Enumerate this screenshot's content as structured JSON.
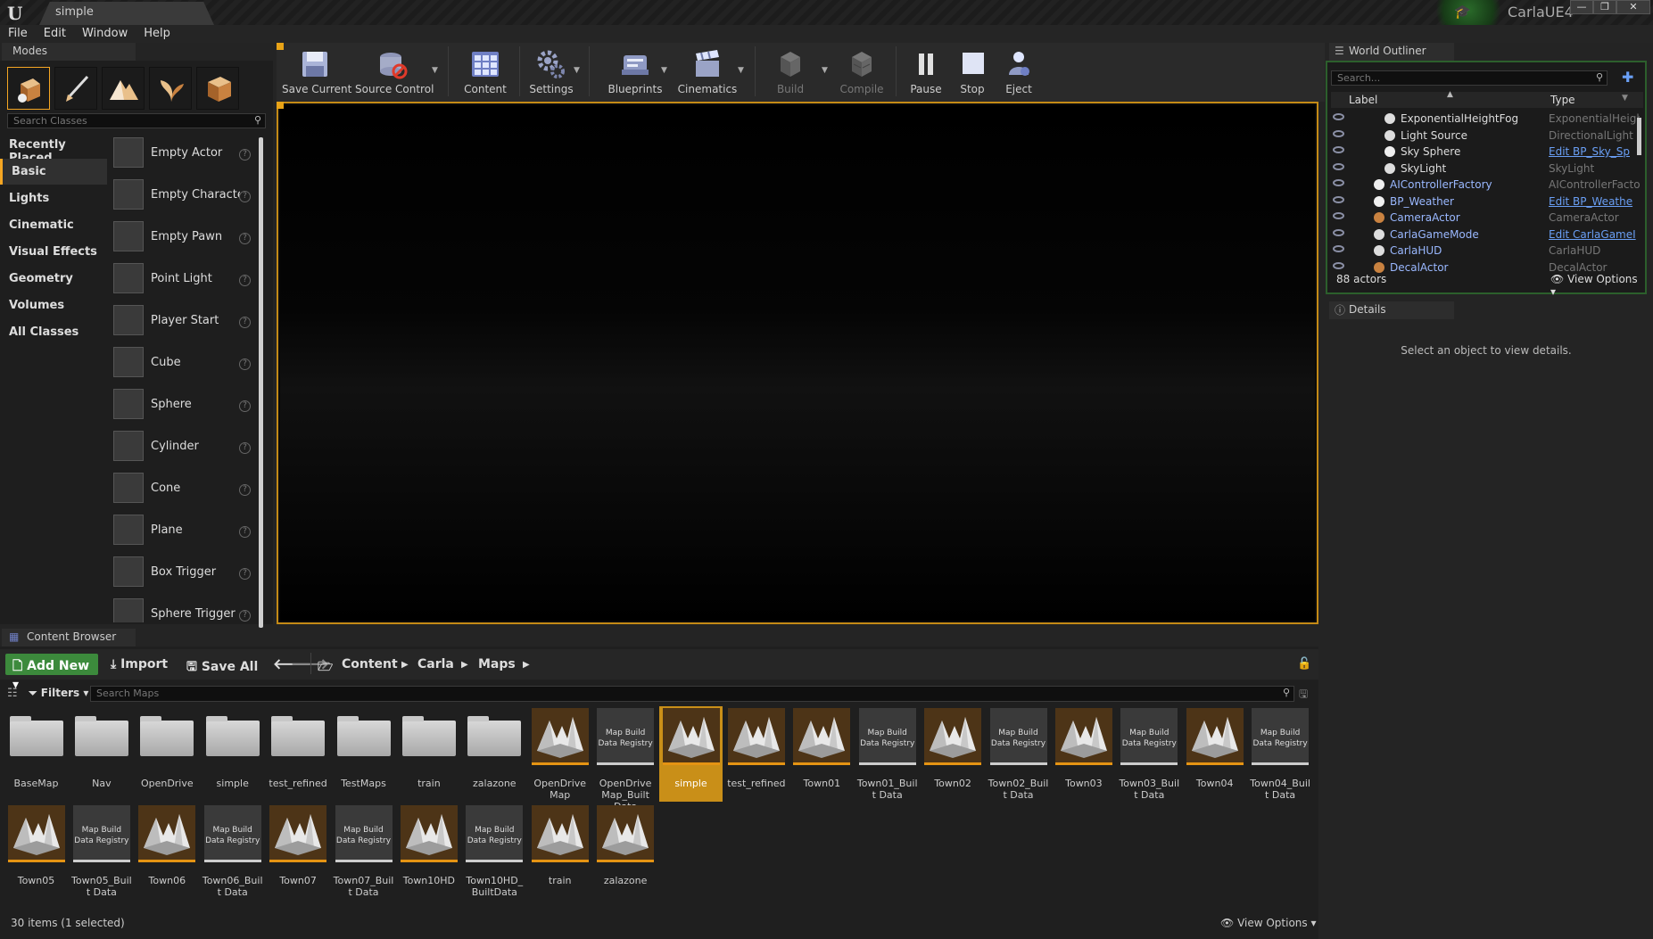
{
  "window": {
    "doc_tab": "simple",
    "project_name": "CarlaUE4",
    "minimize": "—",
    "maximize": "❐",
    "close": "✕"
  },
  "menu": [
    "File",
    "Edit",
    "Window",
    "Help"
  ],
  "modes": {
    "tab_label": "Modes",
    "search_placeholder": "Search Classes",
    "categories": [
      "Recently Placed",
      "Basic",
      "Lights",
      "Cinematic",
      "Visual Effects",
      "Geometry",
      "Volumes",
      "All Classes"
    ],
    "active_category": "Basic",
    "items": [
      {
        "label": "Empty Actor",
        "icon": "sphere-icon"
      },
      {
        "label": "Empty Characte",
        "icon": "character-icon"
      },
      {
        "label": "Empty Pawn",
        "icon": "pawn-icon"
      },
      {
        "label": "Point Light",
        "icon": "lightbulb-icon"
      },
      {
        "label": "Player Start",
        "icon": "player-start-icon"
      },
      {
        "label": "Cube",
        "icon": "cube-icon"
      },
      {
        "label": "Sphere",
        "icon": "sphere-icon"
      },
      {
        "label": "Cylinder",
        "icon": "cylinder-icon"
      },
      {
        "label": "Cone",
        "icon": "cone-icon"
      },
      {
        "label": "Plane",
        "icon": "plane-icon"
      },
      {
        "label": "Box Trigger",
        "icon": "box-trigger-icon"
      },
      {
        "label": "Sphere Trigger",
        "icon": "sphere-trigger-icon"
      }
    ]
  },
  "toolbar": {
    "save_current": "Save Current",
    "source_control": "Source Control",
    "content": "Content",
    "settings": "Settings",
    "blueprints": "Blueprints",
    "cinematics": "Cinematics",
    "build": "Build",
    "compile": "Compile",
    "pause": "Pause",
    "stop": "Stop",
    "eject": "Eject"
  },
  "outliner": {
    "tab_label": "World Outliner",
    "search_placeholder": "Search...",
    "col_label": "Label",
    "col_type": "Type",
    "rows": [
      {
        "label": "ExponentialHeightFog",
        "type": "ExponentialHeigh",
        "link": false,
        "child": true
      },
      {
        "label": "Light Source",
        "type": "DirectionalLight",
        "link": false,
        "child": true
      },
      {
        "label": "Sky Sphere",
        "type": "Edit BP_Sky_Sp",
        "link": true,
        "child": true
      },
      {
        "label": "SkyLight",
        "type": "SkyLight",
        "link": false,
        "child": true
      },
      {
        "label": "AIControllerFactory",
        "type": "AIControllerFacto",
        "link": false,
        "child": false
      },
      {
        "label": "BP_Weather",
        "type": "Edit BP_Weathe",
        "link": true,
        "child": false
      },
      {
        "label": "CameraActor",
        "type": "CameraActor",
        "link": false,
        "child": false
      },
      {
        "label": "CarlaGameMode",
        "type": "Edit CarlaGameI",
        "link": true,
        "child": false
      },
      {
        "label": "CarlaHUD",
        "type": "CarlaHUD",
        "link": false,
        "child": false
      },
      {
        "label": "DecalActor",
        "type": "DecalActor",
        "link": false,
        "child": false
      }
    ],
    "actor_count": "88 actors",
    "view_options": "View Options"
  },
  "details": {
    "tab_label": "Details",
    "empty_message": "Select an object to view details."
  },
  "content_browser": {
    "tab_label": "Content Browser",
    "add_new": "Add New",
    "import": "Import",
    "save_all": "Save All",
    "breadcrumb": [
      "Content",
      "Carla",
      "Maps"
    ],
    "filters": "Filters",
    "search_placeholder": "Search Maps",
    "status": "30 items (1 selected)",
    "view_options": "View Options",
    "assets": [
      {
        "label": "BaseMap",
        "kind": "folder"
      },
      {
        "label": "Nav",
        "kind": "folder"
      },
      {
        "label": "OpenDrive",
        "kind": "folder"
      },
      {
        "label": "simple",
        "kind": "folder"
      },
      {
        "label": "test_refined",
        "kind": "folder"
      },
      {
        "label": "TestMaps",
        "kind": "folder"
      },
      {
        "label": "train",
        "kind": "folder"
      },
      {
        "label": "zalazone",
        "kind": "folder"
      },
      {
        "label": "OpenDrive Map",
        "kind": "map"
      },
      {
        "label": "OpenDrive Map_Built Data",
        "kind": "registry"
      },
      {
        "label": "simple",
        "kind": "map",
        "selected": true
      },
      {
        "label": "test_refined",
        "kind": "map"
      },
      {
        "label": "Town01",
        "kind": "map"
      },
      {
        "label": "Town01_Built Data",
        "kind": "registry"
      },
      {
        "label": "Town02",
        "kind": "map"
      },
      {
        "label": "Town02_Built Data",
        "kind": "registry"
      },
      {
        "label": "Town03",
        "kind": "map"
      },
      {
        "label": "Town03_Built Data",
        "kind": "registry"
      },
      {
        "label": "Town04",
        "kind": "map"
      },
      {
        "label": "Town04_Built Data",
        "kind": "registry"
      },
      {
        "label": "Town05",
        "kind": "map"
      },
      {
        "label": "Town05_Built Data",
        "kind": "registry"
      },
      {
        "label": "Town06",
        "kind": "map"
      },
      {
        "label": "Town06_Built Data",
        "kind": "registry"
      },
      {
        "label": "Town07",
        "kind": "map"
      },
      {
        "label": "Town07_Built Data",
        "kind": "registry"
      },
      {
        "label": "Town10HD",
        "kind": "map"
      },
      {
        "label": "Town10HD_ BuiltData",
        "kind": "registry"
      },
      {
        "label": "train",
        "kind": "map"
      },
      {
        "label": "zalazone",
        "kind": "map"
      }
    ],
    "registry_thumb_text": "Map Build Data Registry"
  },
  "colors": {
    "accent": "#c98f18",
    "add_new_green": "#3c8a3c",
    "outliner_border": "#2c5f2c"
  }
}
